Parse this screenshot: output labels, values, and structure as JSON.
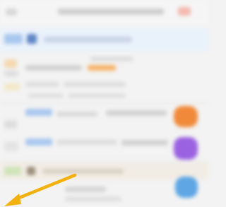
{
  "screen": {
    "topbar_title": "",
    "topbar_action": "",
    "rows": [
      {
        "kind": "highlight",
        "accent": "#5f86c6",
        "label": ""
      },
      {
        "kind": "text",
        "label": "",
        "tag": ""
      },
      {
        "kind": "text",
        "label": "",
        "meta": ""
      },
      {
        "kind": "media",
        "label": "",
        "thumb_color": "#f08a3a"
      },
      {
        "kind": "media",
        "label": "",
        "thumb_color": "#9a62e0"
      },
      {
        "kind": "folder",
        "label": ""
      },
      {
        "kind": "media",
        "label": "",
        "thumb_color": "#5ea6e4"
      }
    ]
  },
  "colors": {
    "background": "#f3f3f3",
    "highlight_row": "#e9f1fb",
    "accent_blue": "#a9c7ee",
    "accent_orange": "#f7b266",
    "gesture_arrow": "#f3b10f"
  },
  "icons": {
    "gesture": "swipe-arrow-icon"
  }
}
